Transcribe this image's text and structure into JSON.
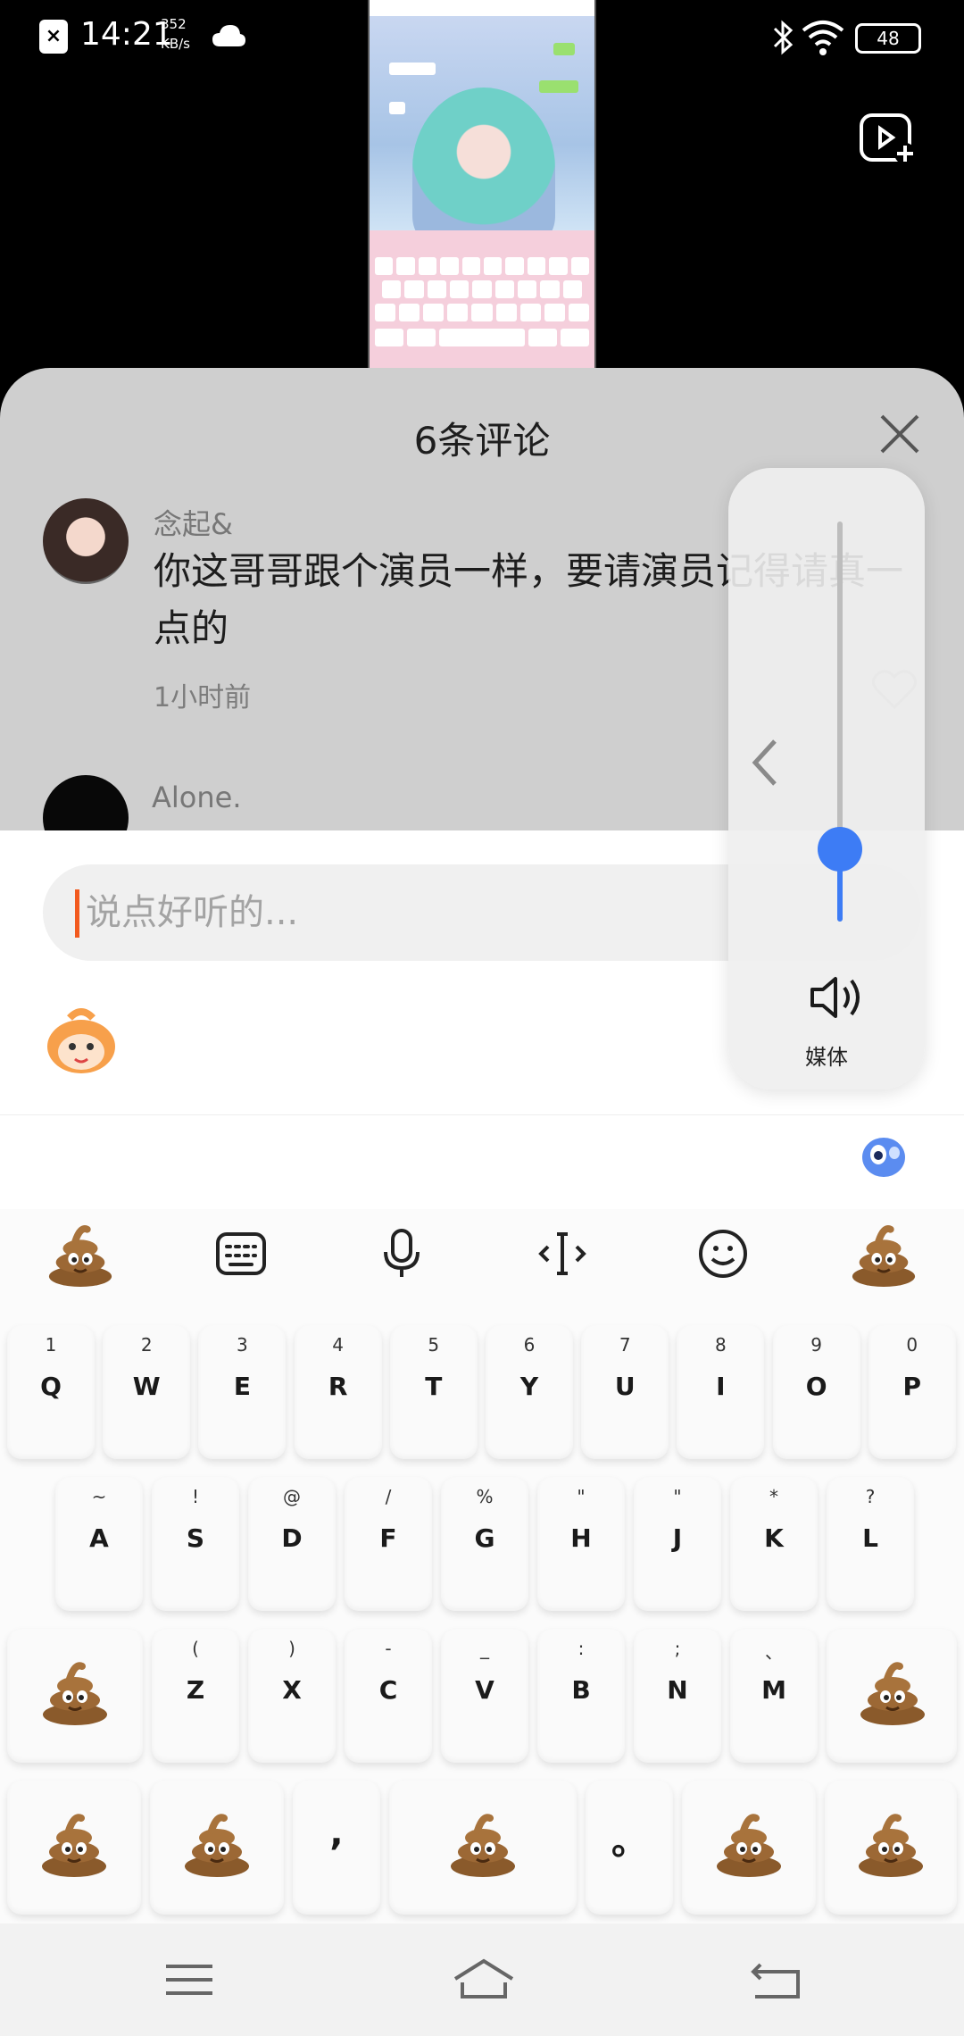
{
  "status_bar": {
    "time": "14:21",
    "speed_value": "352",
    "speed_unit": "KB/s",
    "battery": "48"
  },
  "comments_sheet": {
    "title": "6条评论",
    "comments": [
      {
        "user": "念起&",
        "text": "你这哥哥跟个演员一样，要请演员记得请真一点的",
        "time": "1小时前"
      },
      {
        "user": "Alone."
      }
    ]
  },
  "input": {
    "placeholder": "说点好听的..."
  },
  "volume_panel": {
    "label": "媒体",
    "level": 0.18,
    "accent": "#3d7cf5"
  },
  "keyboard": {
    "toolbar_icons": [
      "poop-emoji-icon",
      "keyboard-icon",
      "microphone-icon",
      "text-cursor-icon",
      "smiley-icon",
      "poop-emoji-icon"
    ],
    "row1": [
      {
        "main": "Q",
        "sub": "1"
      },
      {
        "main": "W",
        "sub": "2"
      },
      {
        "main": "E",
        "sub": "3"
      },
      {
        "main": "R",
        "sub": "4"
      },
      {
        "main": "T",
        "sub": "5"
      },
      {
        "main": "Y",
        "sub": "6"
      },
      {
        "main": "U",
        "sub": "7"
      },
      {
        "main": "I",
        "sub": "8"
      },
      {
        "main": "O",
        "sub": "9"
      },
      {
        "main": "P",
        "sub": "0"
      }
    ],
    "row2": [
      {
        "main": "A",
        "sub": "~"
      },
      {
        "main": "S",
        "sub": "!"
      },
      {
        "main": "D",
        "sub": "@"
      },
      {
        "main": "F",
        "sub": "/"
      },
      {
        "main": "G",
        "sub": "%"
      },
      {
        "main": "H",
        "sub": "\""
      },
      {
        "main": "J",
        "sub": "\""
      },
      {
        "main": "K",
        "sub": "*"
      },
      {
        "main": "L",
        "sub": "?"
      }
    ],
    "row3": [
      {
        "main": "Z",
        "sub": "("
      },
      {
        "main": "X",
        "sub": ")"
      },
      {
        "main": "C",
        "sub": "-"
      },
      {
        "main": "V",
        "sub": "_"
      },
      {
        "main": "B",
        "sub": ":"
      },
      {
        "main": "N",
        "sub": ";"
      },
      {
        "main": "M",
        "sub": "、"
      }
    ],
    "row4_symbols": [
      ",",
      "。"
    ]
  },
  "accent_color": "#f25a1f"
}
